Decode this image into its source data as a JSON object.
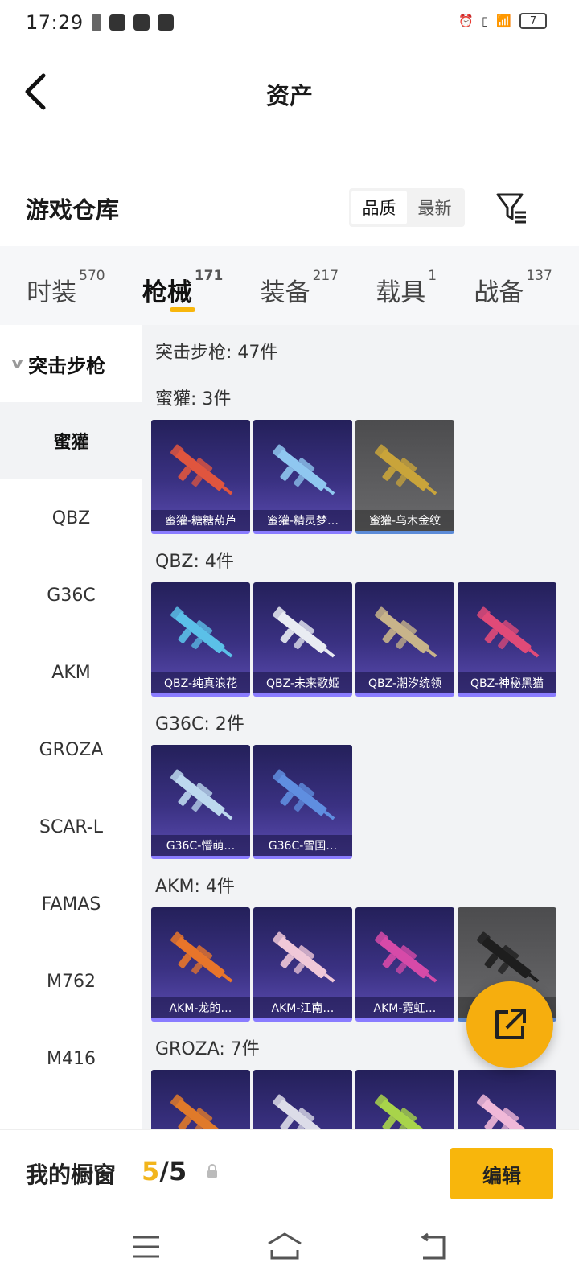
{
  "status_bar": {
    "time": "17:29",
    "battery": "7"
  },
  "header": {
    "title": "资产"
  },
  "warehouse": {
    "title": "游戏仓库",
    "sort_options": [
      "品质",
      "最新"
    ],
    "sort_selected": "品质"
  },
  "tabs": [
    {
      "label": "时装",
      "count": "570"
    },
    {
      "label": "枪械",
      "count": "171",
      "active": true
    },
    {
      "label": "装备",
      "count": "217"
    },
    {
      "label": "载具",
      "count": "1"
    },
    {
      "label": "战备",
      "count": "137"
    }
  ],
  "sidebar": {
    "group": "突击步枪",
    "items": [
      "蜜獾",
      "QBZ",
      "G36C",
      "AKM",
      "GROZA",
      "SCAR-L",
      "FAMAS",
      "M762",
      "M416"
    ],
    "selected": "蜜獾"
  },
  "content": {
    "category_header": "突击步枪: 47件",
    "sections": [
      {
        "label": "蜜獾: 3件",
        "items": [
          {
            "name": "蜜獾-糖糖葫芦",
            "style": "purple",
            "color": "#e0553e"
          },
          {
            "name": "蜜獾-精灵梦…",
            "style": "purple",
            "color": "#8fc7f0"
          },
          {
            "name": "蜜獾-乌木金纹",
            "style": "grey",
            "color": "#c9a43a"
          }
        ]
      },
      {
        "label": "QBZ: 4件",
        "items": [
          {
            "name": "QBZ-纯真浪花",
            "style": "purple",
            "color": "#5bc0e8"
          },
          {
            "name": "QBZ-未来歌姬",
            "style": "purple",
            "color": "#e9ecf2"
          },
          {
            "name": "QBZ-潮汐统领",
            "style": "purple",
            "color": "#c8b48a"
          },
          {
            "name": "QBZ-神秘黑猫",
            "style": "purple",
            "color": "#e04a78"
          }
        ]
      },
      {
        "label": "G36C: 2件",
        "items": [
          {
            "name": "G36C-懵萌…",
            "style": "purple",
            "color": "#bcd8ee"
          },
          {
            "name": "G36C-雪国…",
            "style": "purple",
            "color": "#5f8ee0"
          }
        ]
      },
      {
        "label": "AKM: 4件",
        "items": [
          {
            "name": "AKM-龙的…",
            "style": "purple",
            "color": "#e8752a"
          },
          {
            "name": "AKM-江南…",
            "style": "purple",
            "color": "#f0c8d8"
          },
          {
            "name": "AKM-霓虹…",
            "style": "purple",
            "color": "#d64aa8"
          },
          {
            "name": "",
            "style": "grey",
            "color": "#1e1e1e"
          }
        ]
      },
      {
        "label": "GROZA: 7件",
        "items": [
          {
            "name": "",
            "style": "purple",
            "color": "#e07a2a"
          },
          {
            "name": "",
            "style": "purple",
            "color": "#dcdce8"
          },
          {
            "name": "",
            "style": "purple",
            "color": "#a8d44a"
          },
          {
            "name": "",
            "style": "purple",
            "color": "#f0b8d8"
          }
        ]
      }
    ]
  },
  "showcase": {
    "label": "我的橱窗",
    "current": "5",
    "total": "5",
    "edit_label": "编辑"
  },
  "colors": {
    "accent": "#f8b60c",
    "page_bg": "#f2f3f5",
    "card_purple": "#3a3182",
    "card_grey": "#5e5e60"
  },
  "icons": {
    "back": "back-arrow-icon",
    "filter": "filter-icon",
    "share": "share-external-icon",
    "lock": "lock-icon"
  }
}
